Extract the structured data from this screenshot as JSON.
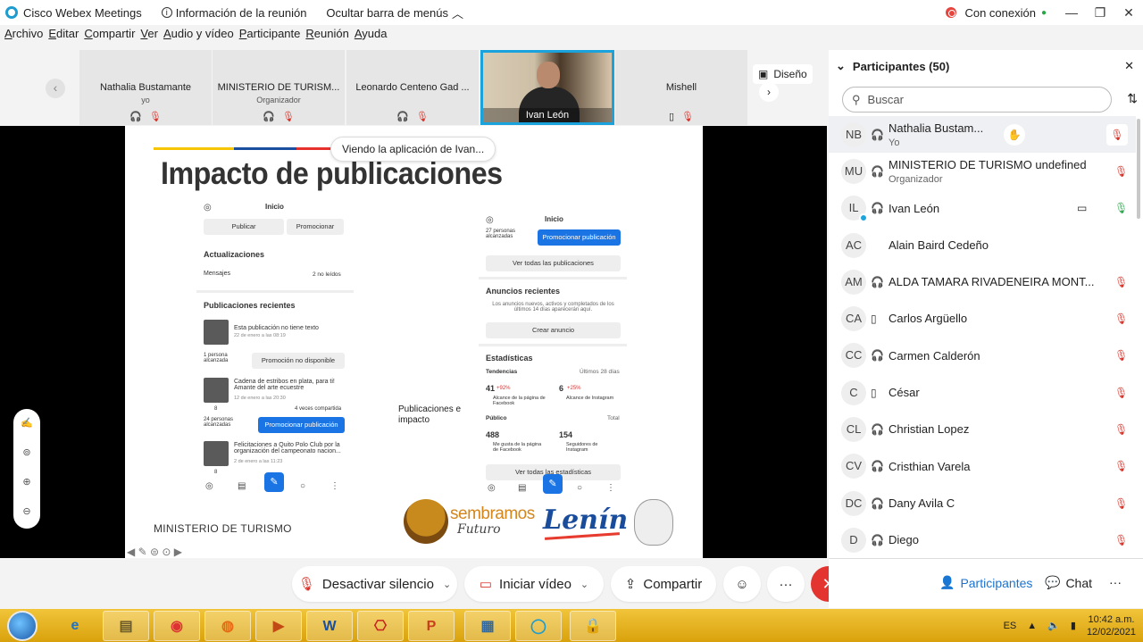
{
  "titlebar": {
    "app_name": "Cisco Webex Meetings",
    "meeting_info": "Información de la reunión",
    "hide_menu": "Ocultar barra de menús",
    "connection": "Con conexión"
  },
  "menu": [
    "Archivo",
    "Editar",
    "Compartir",
    "Ver",
    "Audio y vídeo",
    "Participante",
    "Reunión",
    "Ayuda"
  ],
  "strip": {
    "tiles": [
      {
        "name": "Nathalia Bustamante",
        "sub": "yo"
      },
      {
        "name": "MINISTERIO DE TURISM...",
        "sub": "Organizador"
      },
      {
        "name": "Leonardo Centeno Gad ...",
        "sub": ""
      },
      {
        "name": "Mishell",
        "sub": ""
      }
    ],
    "video_name": "Ivan León",
    "layout_label": "Diseño"
  },
  "slide": {
    "viewing": "Viendo la aplicación de Ivan...",
    "title": "Impacto de publicaciones",
    "left": {
      "inicio": "Inicio",
      "publicar": "Publicar",
      "promocionar": "Promocionar",
      "actualizaciones": "Actualizaciones",
      "mensajes": "Mensajes",
      "no_leidos": "2 no leídos",
      "recientes": "Publicaciones recientes",
      "post1": "Esta publicación no tiene texto",
      "post1_date": "22 de enero a las 08:19",
      "post1_reach": "1 persona alcanzada",
      "promo_na": "Promoción no disponible",
      "post2": "Cadena de estribos en plata, para ti! Amante del arte ecuestre",
      "post2_date": "12 de enero a las 20:30",
      "post2_likes": "8",
      "post2_shared": "4 veces compartida",
      "post2_reach": "24 personas alcanzadas",
      "promo_pub": "Promocionar publicación",
      "post3": "Felicitaciones a Quito Polo Club por la organización del campeonato nacion...",
      "post3_date": "2 de enero a las 11:23",
      "post3_likes": "8"
    },
    "middle": "Publicaciones e impacto",
    "right": {
      "inicio": "Inicio",
      "reach": "27 personas alcanzadas",
      "promo_pub": "Promocionar publicación",
      "ver_todas": "Ver todas las publicaciones",
      "anuncios": "Anuncios recientes",
      "anuncios_desc": "Los anuncios nuevos, activos y completados de los últimos 14 días aparecerán aquí.",
      "crear": "Crear anuncio",
      "estadisticas": "Estadísticas",
      "tendencias": "Tendencias",
      "ultimos": "Últimos 28 días",
      "n1": "41",
      "n1_delta": "+92%",
      "n1_label": "Alcance de la página de Facebook",
      "n2": "6",
      "n2_delta": "+25%",
      "n2_label": "Alcance de Instagram",
      "publico": "Público",
      "total": "Total",
      "n3": "488",
      "n3_label": "Me gusta de la página de Facebook",
      "n4": "154",
      "n4_label": "Seguidores de Instagram",
      "ver_estad": "Ver todas las estadísticas"
    },
    "footer": "MINISTERIO DE TURISMO",
    "logo_sembramos": "sembramos",
    "logo_futuro": "Futuro",
    "logo_lenin": "Lenín"
  },
  "controls": {
    "mute": "Desactivar silencio",
    "video": "Iniciar vídeo",
    "share": "Compartir"
  },
  "panel": {
    "title": "Participantes (50)",
    "search_placeholder": "Buscar",
    "participants": [
      {
        "initials": "NB",
        "name": "Nathalia Bustam...",
        "sub": "Yo"
      },
      {
        "initials": "MU",
        "name": "MINISTERIO DE TURISMO undefined",
        "sub": "Organizador"
      },
      {
        "initials": "IL",
        "name": "Ivan León",
        "sub": ""
      },
      {
        "initials": "AC",
        "name": "Alain Baird Cedeño",
        "sub": ""
      },
      {
        "initials": "AM",
        "name": "ALDA TAMARA RIVADENEIRA MONT...",
        "sub": ""
      },
      {
        "initials": "CA",
        "name": "Carlos Argüello",
        "sub": ""
      },
      {
        "initials": "CC",
        "name": "Carmen Calderón",
        "sub": ""
      },
      {
        "initials": "C",
        "name": "César",
        "sub": ""
      },
      {
        "initials": "CL",
        "name": "Christian Lopez",
        "sub": ""
      },
      {
        "initials": "CV",
        "name": "Cristhian Varela",
        "sub": ""
      },
      {
        "initials": "DC",
        "name": "Dany Avila C",
        "sub": ""
      },
      {
        "initials": "D",
        "name": "Diego",
        "sub": ""
      }
    ],
    "tab_participants": "Participantes",
    "tab_chat": "Chat"
  },
  "taskbar": {
    "lang": "ES",
    "time": "10:42 a.m.",
    "date": "12/02/2021"
  }
}
